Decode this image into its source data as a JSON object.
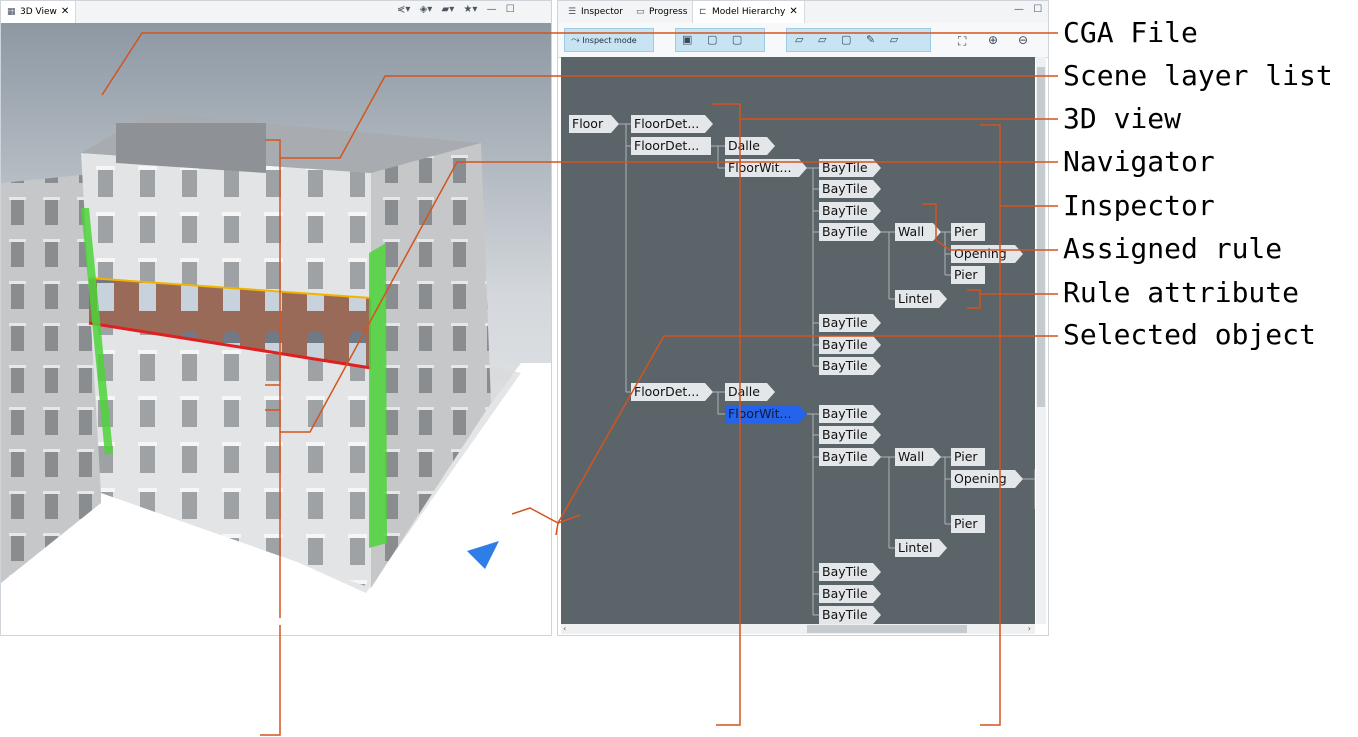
{
  "left_panel": {
    "tab_label": "3D View",
    "tab_close": "✕",
    "toolbar_icons": [
      "share-icon",
      "layers-icon",
      "camera-icon",
      "star-icon"
    ],
    "toolbar_glyphs": [
      "⋞▾",
      "◈▾",
      "▰▾",
      "★▾",
      "—",
      "☐"
    ]
  },
  "right_panel": {
    "tabs": [
      {
        "label": "Inspector",
        "icon": "☰"
      },
      {
        "label": "Progress",
        "icon": "▭"
      },
      {
        "label": "Model Hierarchy",
        "icon": "⊏"
      }
    ],
    "tab_close": "✕",
    "window_controls": [
      "—",
      "☐"
    ],
    "inspect_mode_label": "Inspect mode",
    "hierarchy": {
      "floor": "Floor",
      "floordet_1": "FloorDet...",
      "floordet_2": "FloorDet...",
      "floordet_3": "FloorDet...",
      "dalle_1": "Dalle",
      "dalle_2": "Dalle",
      "floorwit_1": "FloorWit...",
      "floorwit_2": "FloorWit...",
      "baytile": "BayTile",
      "wall": "Wall",
      "pier": "Pier",
      "opening": "Opening",
      "lintel": "Lintel"
    }
  },
  "callouts": {
    "cga_file": "CGA File",
    "scene_layer_list": "Scene layer list",
    "view_3d": "3D view",
    "navigator": "Navigator",
    "inspector": "Inspector",
    "assigned_rule": "Assigned rule",
    "rule_attribute": "Rule attribute",
    "selected_object": "Selected object"
  },
  "colors": {
    "leader": "#d3541f",
    "canvas": "#5b6469",
    "node": "#e4e7ea",
    "selected_node": "#2563eb",
    "green_highlight": "#4cd43a",
    "red_highlight": "#e02020"
  }
}
